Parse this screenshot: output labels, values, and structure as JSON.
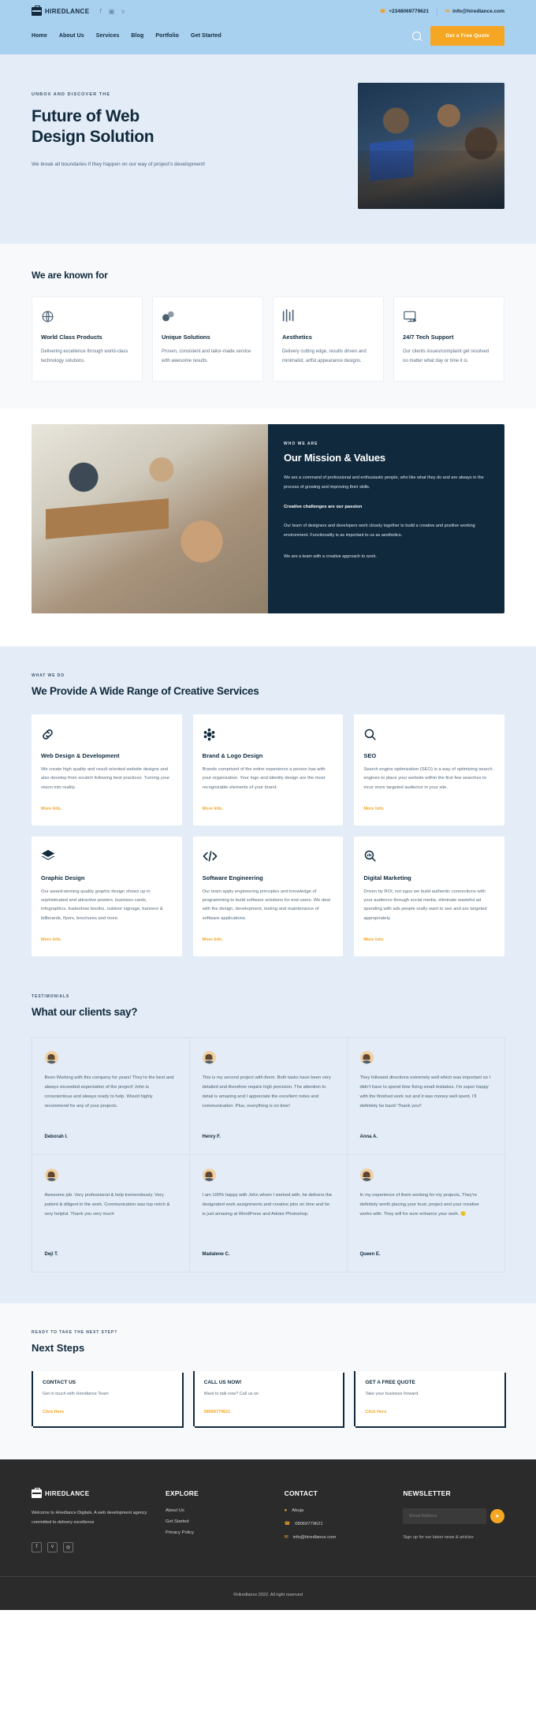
{
  "topbar": {
    "brand": "HIREDLANCE",
    "socials": [
      "f",
      "▣",
      "ᴠ"
    ],
    "phone": "+2348069779621",
    "email": "info@hiredlance.com"
  },
  "nav": {
    "items": [
      "Home",
      "About Us",
      "Services",
      "Blog",
      "Portfolio",
      "Get Started"
    ],
    "cta": "Get a Free Quote"
  },
  "hero": {
    "eyebrow": "UNBOX AND DISCOVER THE",
    "title_line1": "Future of Web",
    "title_line2": "Design Solution",
    "subtitle": "We break all boundaries if they happen on our way of project's development!"
  },
  "known": {
    "title": "We are known for",
    "cards": [
      {
        "icon": "globe-icon",
        "title": "World Class Products",
        "text": "Delivering excellence through world-class technology solutions."
      },
      {
        "icon": "shapes-icon",
        "title": "Unique Solutions",
        "text": "Proven, consistent and tailor-made service with awesome results."
      },
      {
        "icon": "bars-icon",
        "title": "Aesthetics",
        "text": "Delivery cutting edge, results driven and minimalist, artful appearance designs."
      },
      {
        "icon": "support-icon",
        "title": "24/7 Tech Support",
        "text": "Our clients issues/complaint get resolved no matter what day or time it is."
      }
    ]
  },
  "mission": {
    "eyebrow": "WHO WE ARE",
    "title": "Our Mission & Values",
    "p1": "We are a command of professional and enthusiastic people, who like what they do and are always in the process of growing and improving their skills.",
    "highlight": "Creative challenges are our passion",
    "p2": "Our team of designers and developers work closely together to build a creative and positive working environment. Functionality is as important to us as aesthetics.",
    "p3": "We are a team with a creative approach to work."
  },
  "services": {
    "eyebrow": "WHAT WE DO",
    "title": "We Provide A Wide Range of Creative Services",
    "more_label": "More Info.",
    "cards": [
      {
        "icon": "link-icon",
        "title": "Web Design & Development",
        "text": "We create high quality and result oriented website designs and also develop from scratch following best practices. Turning your vision into reality."
      },
      {
        "icon": "palette-icon",
        "title": "Brand & Logo Design",
        "text": "Brands comprised of the entire experience a person has with your organization. Your logo and identity design are the most recognizable elements of your brand."
      },
      {
        "icon": "magnifier-icon",
        "title": "SEO",
        "text": "Search engine optimization (SEO) is a way of optimizing search engines to place your website within the first few searches to incur more targeted audience in your site."
      },
      {
        "icon": "layers-icon",
        "title": "Graphic Design",
        "text": "Our award-winning quality graphic design shows up in sophisticated and attractive posters, business cards, infographics, tradeshow booths, outdoor signage, banners & billboards, flyers, brochures and more."
      },
      {
        "icon": "code-icon",
        "title": "Software Engineering",
        "text": "Our team apply engineering principles and knowledge of programming to build software solutions for end users. We deal with the design, development, testing and maintenance of software applications."
      },
      {
        "icon": "search-chart-icon",
        "title": "Digital Marketing",
        "text": "Driven by ROI, not egos we build authentic connections with your audience through social media, eliminate wasteful ad spending with ads people really want to see and are targeted appropriately."
      }
    ]
  },
  "testimonials": {
    "eyebrow": "TESTIMONIALS",
    "title": "What our clients say?",
    "items": [
      {
        "text": "Been Working with this company for years! They're the best and always exceeded expectation of the project! John is conscientious and always ready to help. Would highly recommend for any of your projects.",
        "name": "Deborah I."
      },
      {
        "text": "This is my second project with them. Both tasks have been very detailed and therefore require high precision. The attention to detail is amazing and I appreciate the excellent notes and communication. Plus, everything is on time!",
        "name": "Henry F."
      },
      {
        "text": "They followed directions extremely well which was important so I didn't have to spend time fixing small mistakes. I'm super happy with the finished work out and it was money well spent. I'll definitely be back! Thank you!!",
        "name": "Anna A."
      },
      {
        "text": "Awesome job. Very professional & help tremendously. Very patient & diligent in the work. Communication was top notch & very helpful. Thank you very much",
        "name": "Deji T."
      },
      {
        "text": "I am 100% happy with John whom I worked with, he delivers the designated work assignments and creative jobs on time and he is just amazing at WordPress and Adobe Photoshop.",
        "name": "Madalene C."
      },
      {
        "text": "In my experience of them working for my projects, They're definitely worth placing your trust, project and your creative works with. They will for sure enhance your work. 🙂",
        "name": "Queen E."
      }
    ]
  },
  "next_steps": {
    "eyebrow": "READY TO TAKE THE NEXT STEP?",
    "title": "Next Steps",
    "cards": [
      {
        "title": "CONTACT US",
        "text": "Get in touch with Hiredlance Team",
        "link": "Click Here",
        "link_color": "#f5a623"
      },
      {
        "title": "CALL US NOW!",
        "text": "Want to talk now? Call us on",
        "link": "08069779621",
        "link_color": "#f5a623"
      },
      {
        "title": "GET A FREE QUOTE",
        "text": "Take your business forward.",
        "link": "Click Here",
        "link_color": "#f5a623"
      }
    ]
  },
  "footer": {
    "brand": "HIREDLANCE",
    "about": "Welcome to Hiredlance Digitals. A web development agency committed to delivery excellence",
    "socials": [
      "f",
      "ᴠ",
      "◎"
    ],
    "explore": {
      "heading": "EXPLORE",
      "links": [
        "About Us",
        "Get Started",
        "Privacy Policy"
      ]
    },
    "contact": {
      "heading": "CONTACT",
      "items": [
        {
          "icon": "pin-icon",
          "text": "Abuja"
        },
        {
          "icon": "phone-icon",
          "text": "08069779621"
        },
        {
          "icon": "mail-icon",
          "text": "info@hiredlance.com"
        }
      ]
    },
    "newsletter": {
      "heading": "NEWSLETTER",
      "placeholder": "Email Address",
      "send_icon": "send-icon",
      "note": "Sign up for our latest news & articles"
    },
    "copyright": "©Hiredlance 2022. All right reserved"
  },
  "colors": {
    "topbar_bg": "#a8d0ef",
    "accent": "#f5a623",
    "dark": "#10293d",
    "hero_bg": "#e4ecf7",
    "footer_bg": "#2b2b2b"
  }
}
